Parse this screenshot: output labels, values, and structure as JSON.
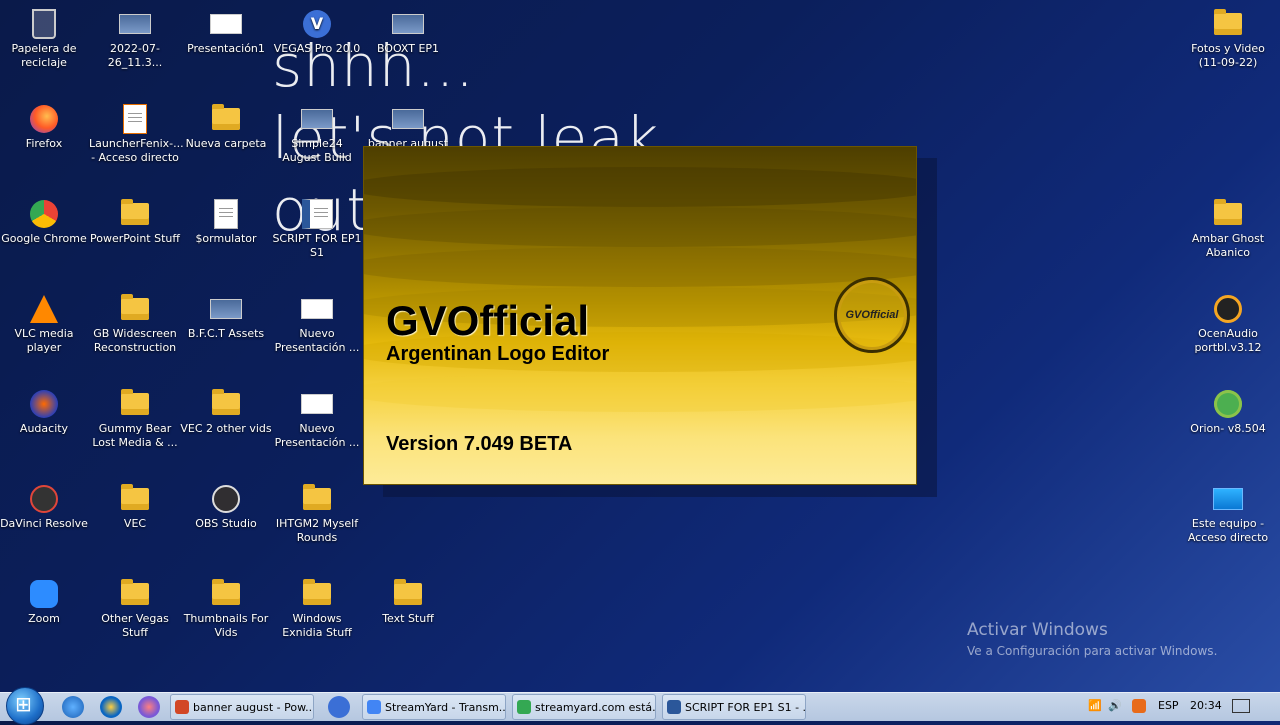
{
  "wallpaper": {
    "line1": "shhh...",
    "line2": "let's not leak",
    "line3": "out"
  },
  "icons": [
    {
      "label": "Papelera de reciclaje",
      "name": "recycle-bin-icon"
    },
    {
      "label": "2022-07-26_11.3...",
      "name": "image-file-icon"
    },
    {
      "label": "Presentación1",
      "name": "presentation-file-icon"
    },
    {
      "label": "VEGAS Pro 20.0",
      "name": "vegas-pro-icon"
    },
    {
      "label": "BOOXT EP1",
      "name": "image-file-icon"
    },
    {
      "label": "Fotos y Video (11-09-22)",
      "name": "folder-icon"
    },
    {
      "label": "Firefox",
      "name": "firefox-icon"
    },
    {
      "label": "LauncherFenix-... - Acceso directo",
      "name": "java-icon"
    },
    {
      "label": "Nueva carpeta",
      "name": "folder-icon"
    },
    {
      "label": "Simple24 August Build",
      "name": "image-file-icon"
    },
    {
      "label": "banner august",
      "name": "image-file-icon"
    },
    {
      "label": "Google Chrome",
      "name": "chrome-icon"
    },
    {
      "label": "PowerPoint  Stuff",
      "name": "folder-icon"
    },
    {
      "label": "$ormulator",
      "name": "document-icon"
    },
    {
      "label": "SCRIPT FOR EP1 S1",
      "name": "word-document-icon"
    },
    {
      "label": "Ambar Ghost Abanico",
      "name": "folder-icon"
    },
    {
      "label": "VLC media player",
      "name": "vlc-icon"
    },
    {
      "label": "GB Widescreen Reconstruction",
      "name": "folder-icon"
    },
    {
      "label": "B.F.C.T Assets",
      "name": "image-file-icon"
    },
    {
      "label": "Nuevo Presentación ...",
      "name": "presentation-file-icon"
    },
    {
      "label": "OcenAudio portbl.v3.12",
      "name": "ocenaudio-icon"
    },
    {
      "label": "Audacity",
      "name": "audacity-icon"
    },
    {
      "label": "Gummy Bear Lost Media & ...",
      "name": "folder-icon"
    },
    {
      "label": "VEC 2 other vids",
      "name": "folder-icon"
    },
    {
      "label": "Nuevo Presentación ...",
      "name": "presentation-file-icon"
    },
    {
      "label": "Orion- v8.504",
      "name": "gear-icon"
    },
    {
      "label": "DaVinci Resolve",
      "name": "davinci-resolve-icon"
    },
    {
      "label": "VEC",
      "name": "folder-icon"
    },
    {
      "label": "OBS Studio",
      "name": "obs-icon"
    },
    {
      "label": "IHTGM2 Myself Rounds",
      "name": "folder-icon"
    },
    {
      "label": "Este equipo - Acceso directo",
      "name": "computer-icon"
    },
    {
      "label": "Zoom",
      "name": "zoom-icon"
    },
    {
      "label": "Other Vegas Stuff",
      "name": "folder-icon"
    },
    {
      "label": "Thumbnails For Vids",
      "name": "folder-icon"
    },
    {
      "label": "Windows Exnidia Stuff",
      "name": "folder-icon"
    },
    {
      "label": "Text Stuff",
      "name": "folder-icon"
    }
  ],
  "splash": {
    "title": "GVOfficial",
    "subtitle": "Argentinan Logo Editor",
    "version": "Version 7.049 BETA",
    "logo_text": "GVOfficial"
  },
  "activation": {
    "title": "Activar Windows",
    "message": "Ve a Configuración para activar Windows."
  },
  "taskbar": {
    "tasks": [
      {
        "label": "banner august - Pow...",
        "name": "taskbar-item-powerpoint",
        "color": "#d24726"
      },
      {
        "label": "StreamYard - Transm...",
        "name": "taskbar-item-chrome-streamyard",
        "color": "#4285f4"
      },
      {
        "label": "streamyard.com está...",
        "name": "taskbar-item-chrome-streamyard-share",
        "color": "#34a853"
      },
      {
        "label": "SCRIPT FOR EP1 S1 - ...",
        "name": "taskbar-item-word",
        "color": "#2b579a"
      }
    ],
    "language": "ESP",
    "time": "20:34"
  },
  "colors": {
    "folder": "#f5c542",
    "taskbar": "#c9d7ea",
    "splash_dark": "#4e3f00",
    "splash_light": "#fdeb98"
  }
}
